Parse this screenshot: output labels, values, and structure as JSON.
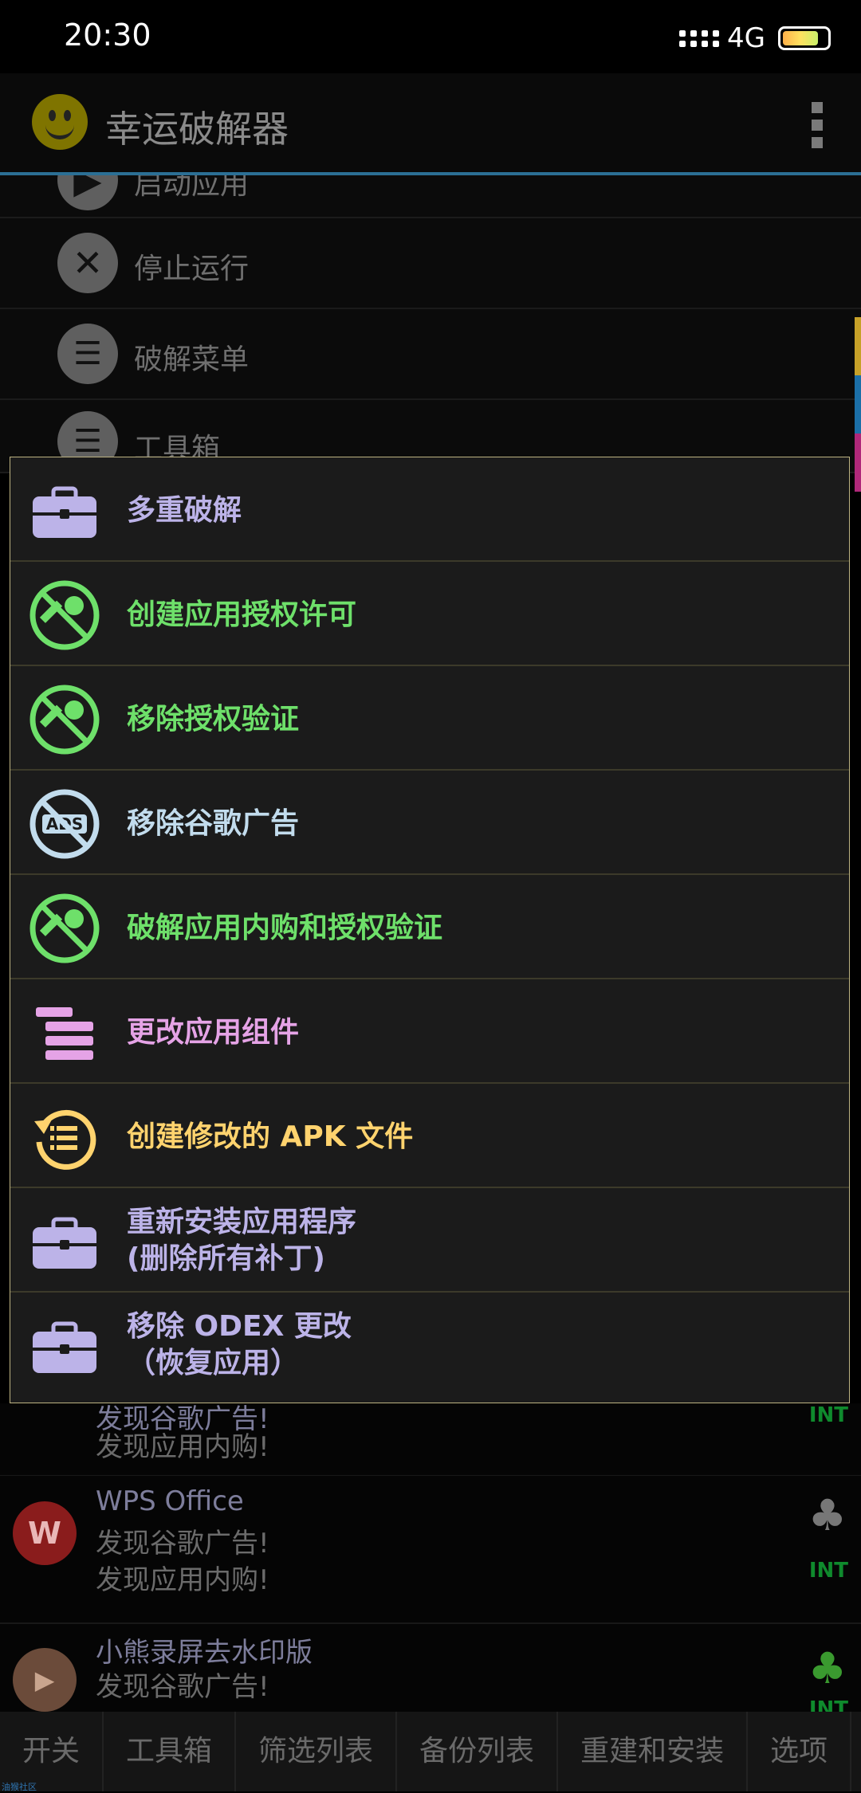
{
  "status": {
    "time": "20:30",
    "network": "4G"
  },
  "app": {
    "title": "幸运破解器"
  },
  "bg_menu": [
    {
      "label": "启动应用"
    },
    {
      "label": "停止运行"
    },
    {
      "label": "破解菜单"
    },
    {
      "label": "工具箱"
    }
  ],
  "dialog": {
    "items": [
      {
        "label": "多重破解",
        "icon": "briefcase-icon",
        "color": "#bcb3e8"
      },
      {
        "label": "创建应用授权许可",
        "icon": "no-key-icon",
        "color": "#6ee06a"
      },
      {
        "label": "移除授权验证",
        "icon": "no-key-icon",
        "color": "#6ee06a"
      },
      {
        "label": "移除谷歌广告",
        "icon": "no-ads-icon",
        "color": "#c2dced"
      },
      {
        "label": "破解应用内购和授权验证",
        "icon": "no-key-icon",
        "color": "#6ee06a"
      },
      {
        "label": "更改应用组件",
        "icon": "components-list-icon",
        "color": "#e5a3e6"
      },
      {
        "label": "创建修改的 APK 文件",
        "icon": "rebuild-list-icon",
        "color": "#ffd36e"
      },
      {
        "label": "重新安装应用程序",
        "label2": "(删除所有补丁)",
        "icon": "briefcase-icon",
        "color": "#bcb3e8"
      },
      {
        "label": "移除 ODEX 更改",
        "label2": "（恢复应用）",
        "icon": "briefcase-icon",
        "color": "#bcb3e8"
      }
    ]
  },
  "app_list": [
    {
      "title": "发现谷歌广告!",
      "line1": "发现应用内购!",
      "badge": "INT"
    },
    {
      "title": "WPS Office",
      "line1": "发现谷歌广告!",
      "line2": "发现应用内购!",
      "badge": "INT"
    },
    {
      "title": "小熊录屏去水印版",
      "line1": "发现谷歌广告!",
      "badge": "INT"
    }
  ],
  "tabs": [
    "开关",
    "工具箱",
    "筛选列表",
    "备份列表",
    "重建和安装",
    "选项"
  ],
  "footnote": "油猴社区"
}
